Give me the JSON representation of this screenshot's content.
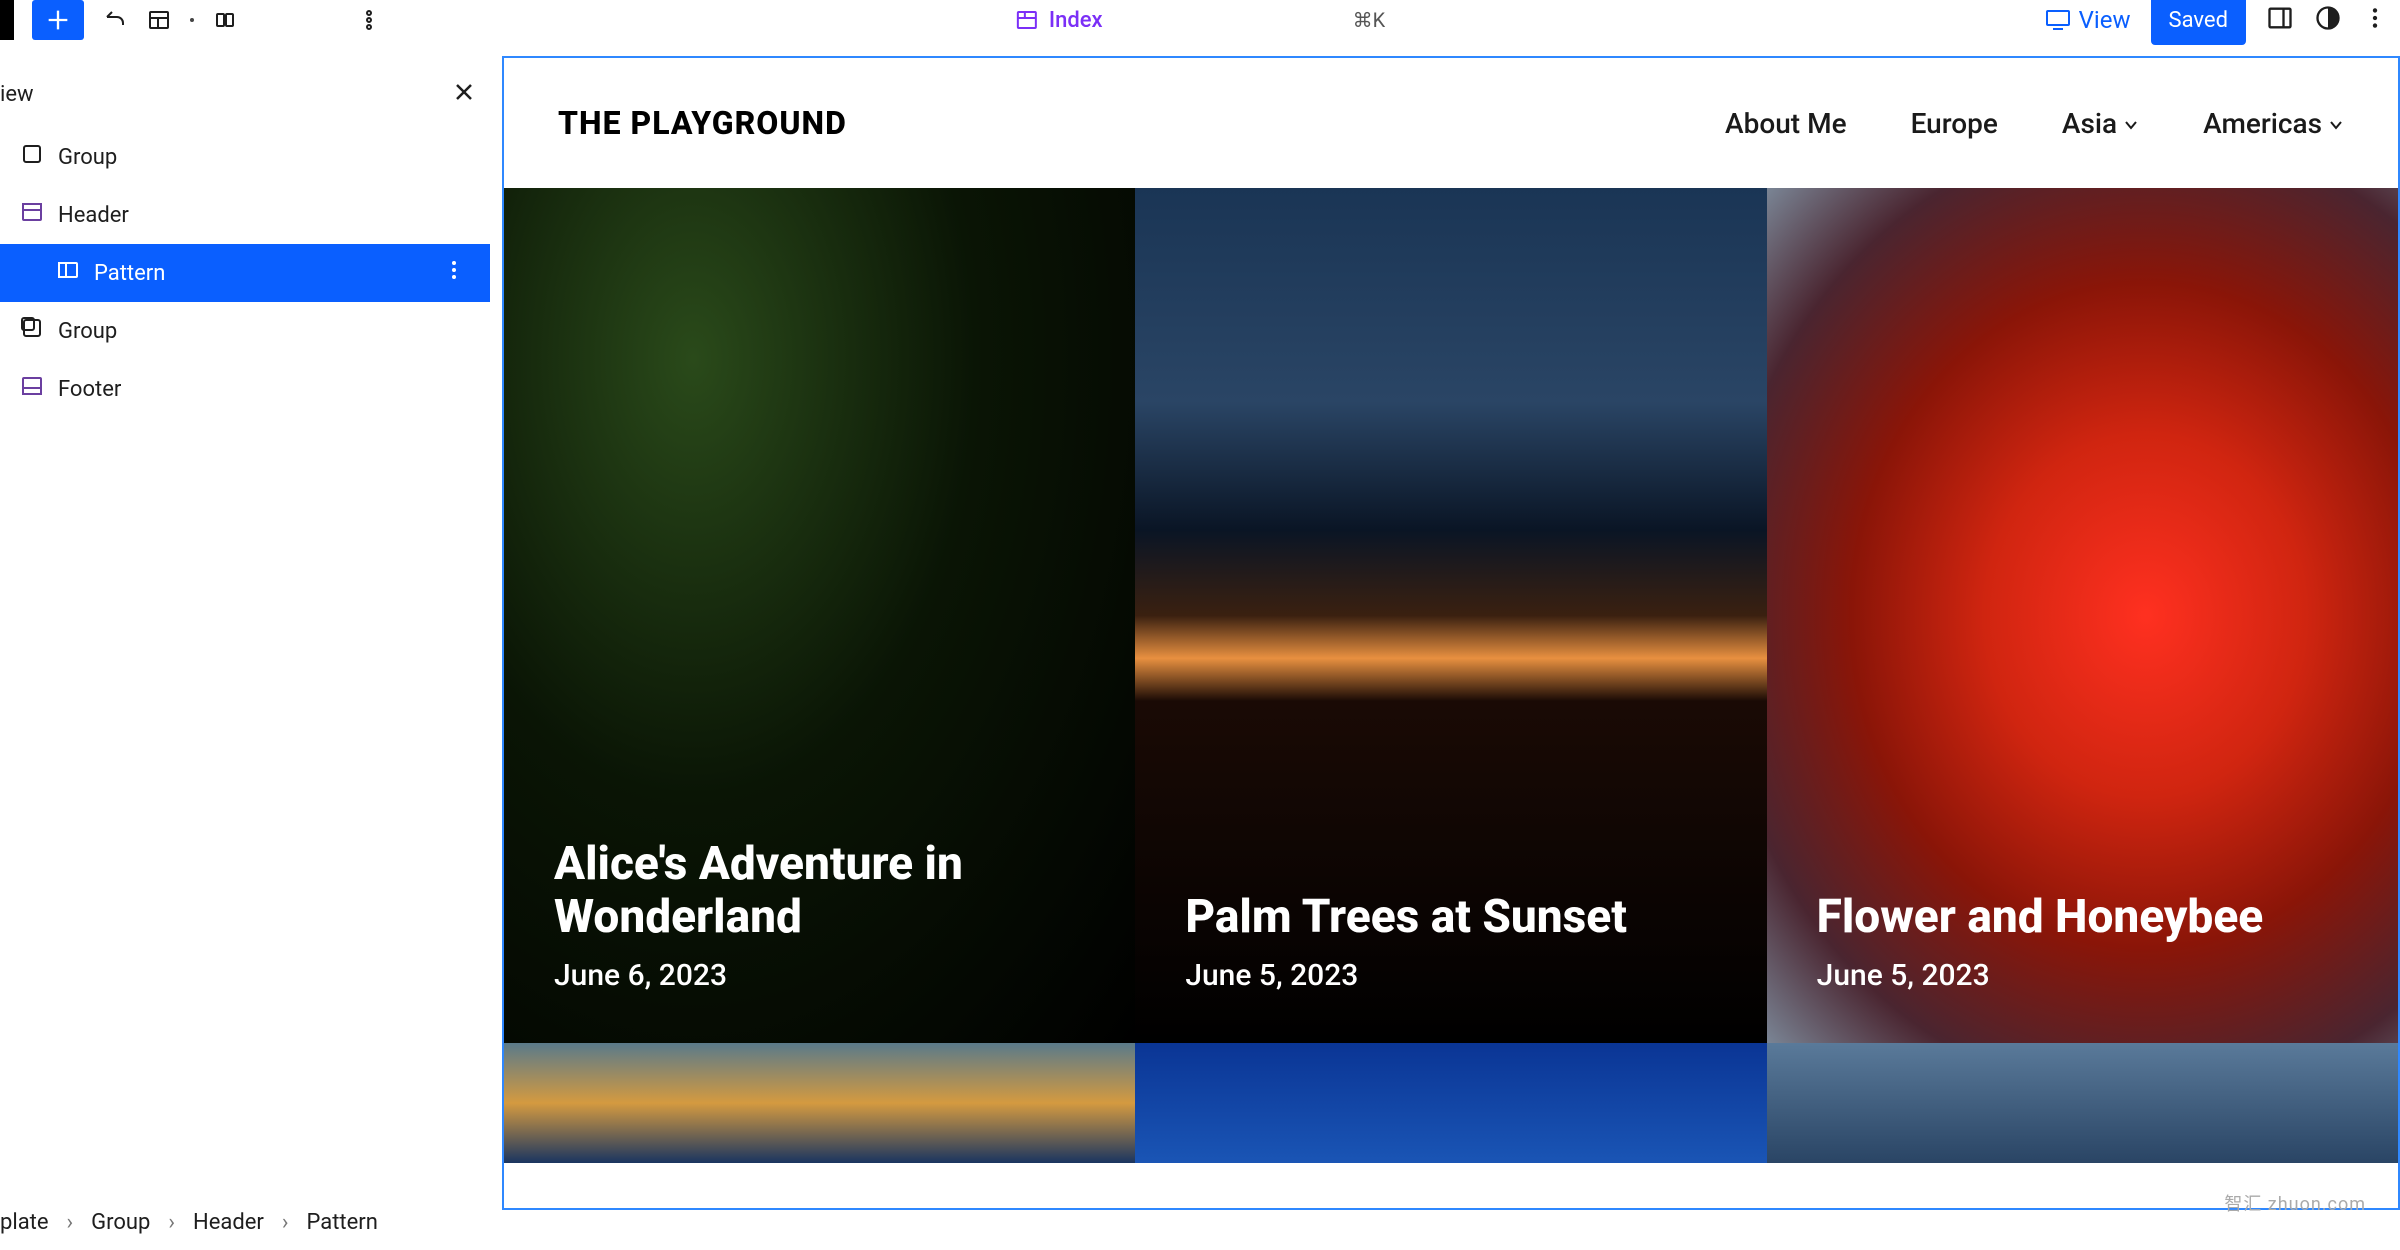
{
  "topbar": {
    "index_label": "Index",
    "shortcut": "⌘K",
    "view_label": "View",
    "saved_label": "Saved"
  },
  "sidebar": {
    "title": "iew",
    "items": [
      {
        "label": "Group"
      },
      {
        "label": "Header"
      },
      {
        "label": "Pattern",
        "selected": true
      },
      {
        "label": "Group"
      },
      {
        "label": "Footer"
      }
    ]
  },
  "site": {
    "title": "THE PLAYGROUND",
    "nav": [
      {
        "label": "About Me",
        "dropdown": false
      },
      {
        "label": "Europe",
        "dropdown": false
      },
      {
        "label": "Asia",
        "dropdown": true
      },
      {
        "label": "Americas",
        "dropdown": true
      }
    ],
    "posts": [
      {
        "title": "Alice's Adventure in Wonderland",
        "date": "June 6, 2023"
      },
      {
        "title": "Palm Trees at Sunset",
        "date": "June 5, 2023"
      },
      {
        "title": "Flower and Honeybee",
        "date": "June 5, 2023"
      }
    ]
  },
  "breadcrumb": [
    "plate",
    "Group",
    "Header",
    "Pattern"
  ],
  "watermark": "智汇 zhuon.com"
}
